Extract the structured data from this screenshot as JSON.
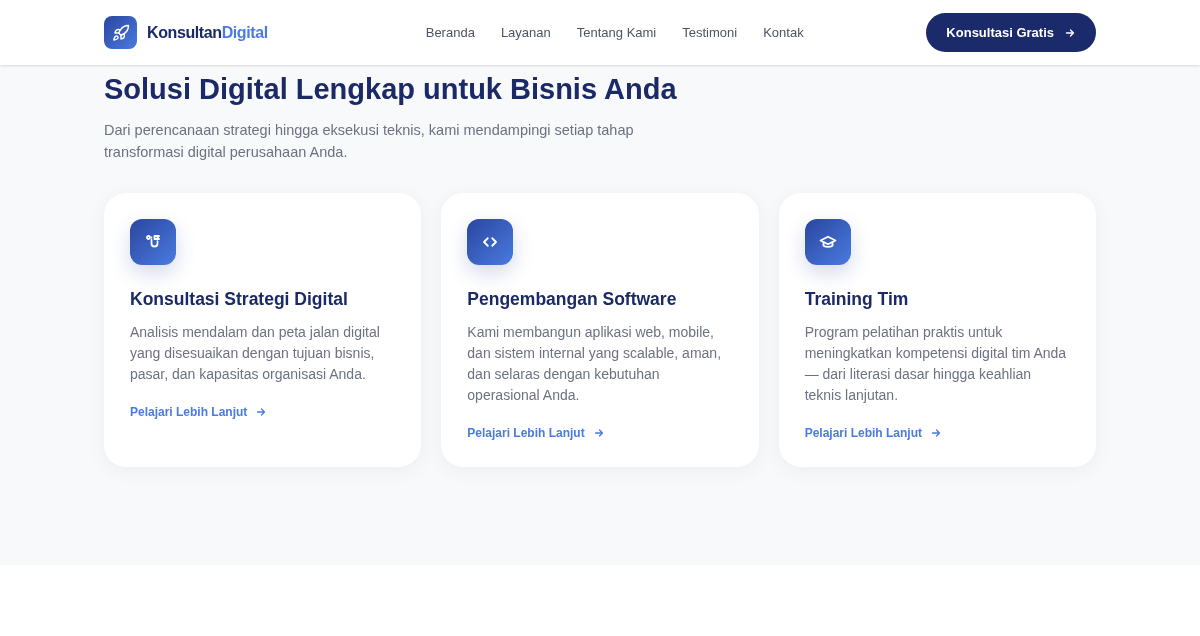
{
  "header": {
    "logo": {
      "name": "Konsultan",
      "accent": "Digital"
    },
    "nav": [
      {
        "label": "Beranda"
      },
      {
        "label": "Layanan"
      },
      {
        "label": "Tentang Kami"
      },
      {
        "label": "Testimoni"
      },
      {
        "label": "Kontak"
      }
    ],
    "cta": "Konsultasi Gratis"
  },
  "section": {
    "heading": "Solusi Digital Lengkap untuk Bisnis Anda",
    "subtitle": "Dari perencanaan strategi hingga eksekusi teknis, kami mendampingi setiap tahap transformasi digital perusahaan Anda.",
    "cards": [
      {
        "kind": "strategy",
        "title": "Konsultasi Strategi Digital",
        "text": "Analisis mendalam dan peta jalan digital yang disesuaikan dengan tujuan bisnis, pasar, dan kapasitas organisasi Anda.",
        "link": "Pelajari Lebih Lanjut"
      },
      {
        "kind": "code",
        "title": "Pengembangan Software",
        "text": "Kami membangun aplikasi web, mobile, dan sistem internal yang scalable, aman, dan selaras dengan kebutuhan operasional Anda.",
        "link": "Pelajari Lebih Lanjut"
      },
      {
        "kind": "training",
        "title": "Training Tim",
        "text": "Program pelatihan praktis untuk meningkatkan kompetensi digital tim Anda — dari literasi dasar hingga keahlian teknis lanjutan.",
        "link": "Pelajari Lebih Lanjut"
      }
    ]
  }
}
